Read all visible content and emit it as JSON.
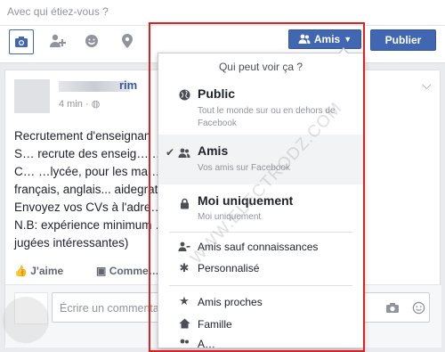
{
  "composer": {
    "placeholder": "Avec qui étiez-vous ?",
    "audience_label": "Amis",
    "publish_label": "Publier",
    "tools": [
      "camera-icon",
      "tag-people-icon",
      "feeling-icon",
      "location-icon"
    ]
  },
  "post": {
    "author_visible": "rim",
    "time_visible": "4 min",
    "lines": [
      "Recrutement d'enseignan",
      "S… recrute des enseig…                                  …au primaire,",
      "C… …lycée, pour les ma…                                …ience,",
      "français, anglais...                                          aidegratuite",
      "Envoyez vos CVs à l'adre…                              …oo.fr",
      "N.B: expérience minimum …                             …ndidatures",
      "jugées intéressantes)"
    ],
    "like_label": "J'aime",
    "comment_label": "Comme…",
    "comment_placeholder": "Écrire un commentai…"
  },
  "dropdown": {
    "heading": "Qui peut voir ça ?",
    "options": [
      {
        "title": "Public",
        "subtitle": "Tout le monde sur ou en dehors de Facebook",
        "icon": "globe-icon",
        "selected": false
      },
      {
        "title": "Amis",
        "subtitle": "Vos amis sur Facebook",
        "icon": "friends-icon",
        "selected": true
      },
      {
        "title": "Moi uniquement",
        "subtitle": "Moi uniquement",
        "icon": "lock-icon",
        "selected": false
      }
    ],
    "more": [
      {
        "label": "Amis sauf connaissances",
        "icon": "friends-except-icon"
      },
      {
        "label": "Personnalisé",
        "icon": "gear-icon"
      }
    ],
    "lists": [
      {
        "label": "Amis proches",
        "icon": "star-icon"
      },
      {
        "label": "Famille",
        "icon": "house-icon"
      },
      {
        "label": "A…",
        "icon": "friends-icon"
      }
    ]
  },
  "watermark": "WWW.ELECTRODZ.COM",
  "colors": {
    "accent": "#4267b2",
    "highlight": "#e02020"
  }
}
